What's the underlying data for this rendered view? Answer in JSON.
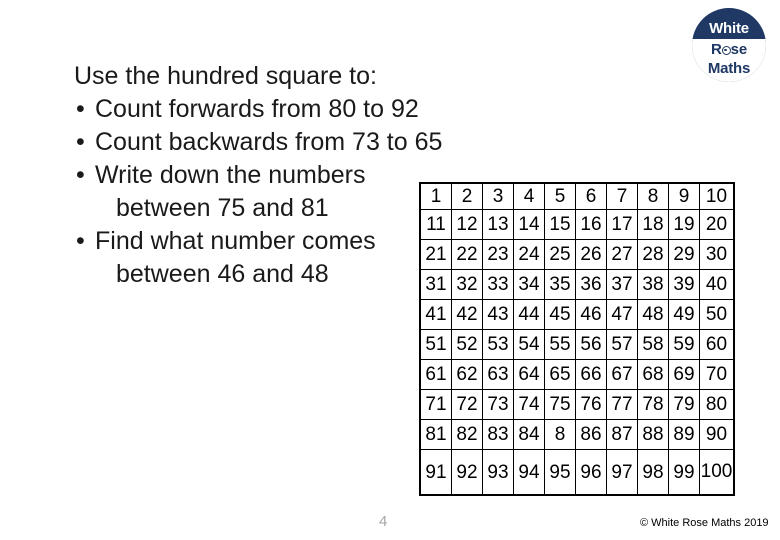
{
  "logo": {
    "line1": "White",
    "line2_before": "R",
    "line2_after": "se",
    "line3": "Maths",
    "navy": "#1f3864"
  },
  "content": {
    "lead": "Use the hundred square to:",
    "bullet_char": "•",
    "bullets": [
      {
        "text": "Count forwards from 80 to 92",
        "continuation": null
      },
      {
        "text": "Count backwards from 73 to 65",
        "continuation": null
      },
      {
        "text": "Write down the numbers",
        "continuation": "between 75 and 81"
      },
      {
        "text": "Find what number comes",
        "continuation": "between 46 and 48"
      }
    ]
  },
  "grid": {
    "rows": [
      [
        "1",
        "2",
        "3",
        "4",
        "5",
        "6",
        "7",
        "8",
        "9",
        "10"
      ],
      [
        "11",
        "12",
        "13",
        "14",
        "15",
        "16",
        "17",
        "18",
        "19",
        "20"
      ],
      [
        "21",
        "22",
        "23",
        "24",
        "25",
        "26",
        "27",
        "28",
        "29",
        "30"
      ],
      [
        "31",
        "32",
        "33",
        "34",
        "35",
        "36",
        "37",
        "38",
        "39",
        "40"
      ],
      [
        "41",
        "42",
        "43",
        "44",
        "45",
        "46",
        "47",
        "48",
        "49",
        "50"
      ],
      [
        "51",
        "52",
        "53",
        "54",
        "55",
        "56",
        "57",
        "58",
        "59",
        "60"
      ],
      [
        "61",
        "62",
        "63",
        "64",
        "65",
        "66",
        "67",
        "68",
        "69",
        "70"
      ],
      [
        "71",
        "72",
        "73",
        "74",
        "75",
        "76",
        "77",
        "78",
        "79",
        "80"
      ],
      [
        "81",
        "82",
        "83",
        "84",
        "8",
        "86",
        "87",
        "88",
        "89",
        "90"
      ],
      [
        "91",
        "92",
        "93",
        "94",
        "95",
        "96",
        "97",
        "98",
        "99",
        "100"
      ]
    ]
  },
  "footer": {
    "page_number": "4",
    "copyright": "© White Rose Maths 2019"
  }
}
